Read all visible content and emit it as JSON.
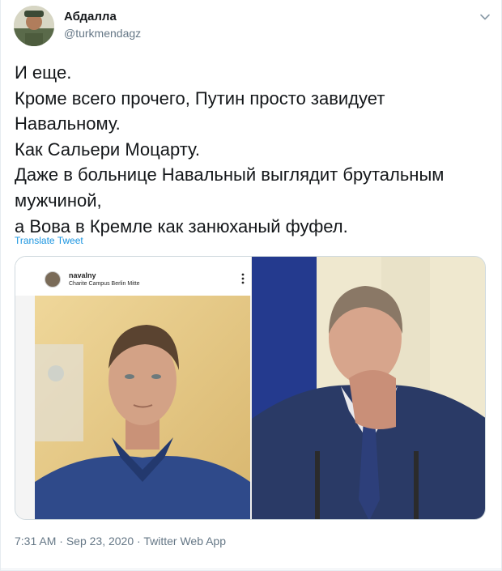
{
  "author": {
    "display_name": "Абдалла",
    "handle": "@turkmendagz"
  },
  "tweet": {
    "lines": [
      "И еще.",
      "Кроме всего прочего,  Путин просто завидует",
      "Навальному.",
      "Как Сальери Моцарту.",
      "Даже в больнице Навальный выглядит брутальным",
      "мужчиной,",
      "а Вова в Кремле как занюханый фуфел."
    ],
    "translate_label": "Translate Tweet"
  },
  "media": {
    "instagram": {
      "username": "navalny",
      "location": "Charite Campus Berlin Mitte"
    }
  },
  "meta": {
    "time": "7:31 AM",
    "date": "Sep 23, 2020",
    "source": "Twitter Web App",
    "separator": " · "
  },
  "colors": {
    "link": "#1b95e0",
    "muted": "#657786",
    "border": "#e6ecf0"
  }
}
